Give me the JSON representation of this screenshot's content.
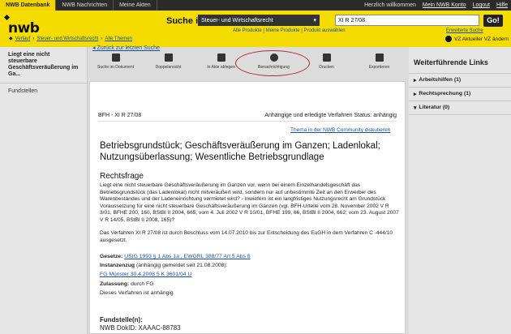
{
  "topbar": {
    "tabs": [
      "NWB Datenbank",
      "NWB Nachrichten",
      "Meine Akten"
    ],
    "greeting": "Herzlich willkommen",
    "links": [
      "Mein NWB Konto",
      "Logout",
      "Hilfe"
    ]
  },
  "header": {
    "logo": "nwb",
    "search_label": "Suche in",
    "search_scope": "Steuer- und Wirtschaftsrecht",
    "search_query": "XI R 27/08",
    "go_label": "Go!",
    "sublinks": "Alle Produkte | Meine Produkte | Produkt auswählen",
    "advanced_search": "Erweiterte Suche"
  },
  "breadcrumb": [
    "Verlauf",
    "Steuer- und Wirtschaftsrecht",
    "Alle Themen"
  ],
  "vz": "VZ  Aktueller VZ ändern",
  "left": {
    "title": "Liegt eine nicht steuerbare Geschäftsveräußerung im Ga...",
    "item": "Fundstellen"
  },
  "back_link": "Zurück zur letzten Suche",
  "toolbar": [
    {
      "icon": "search-doc-icon",
      "label": "Suche im Dokument"
    },
    {
      "icon": "split-view-icon",
      "label": "Doppelansicht"
    },
    {
      "icon": "file-add-icon",
      "label": "In Akte ablegen"
    },
    {
      "icon": "notification-icon",
      "label": "Benachrichtigung"
    },
    {
      "icon": "print-icon",
      "label": "Drucken"
    },
    {
      "icon": "export-icon",
      "label": "Exportieren"
    }
  ],
  "doc": {
    "court_ref": "BFH  - XI R 27/08",
    "status": "Anhängige und erledigte Verfahren Status: anhängig",
    "community": "Thema in der NWB Community diskutieren",
    "headline": "Betriebsgrundstück; Geschäftsveräußerung im Ganzen; Ladenlokal; Nutzungsüberlassung; Wesentliche Betriebsgrundlage",
    "section": "Rechtsfrage",
    "paragraph1": "Liegt eine nicht steuerbare Geschäftsveräußerung im Ganzen vor, wenn bei einem Einzelhandelsgeschäft das Betriebsgrundstück (das Ladenlokal) nicht mitveräußert wird, sondern nur auf unbestimmte Zeit an den Erwerber des Warenbestandes und der Ladeneinrichtung vermietet wird? - Inwiefern ist ein langfristiges Nutzungsrecht am Grundstück Voraussetzung für eine nicht steuerbare Geschäftsveräußerung im Ganzen (vgl. BFH-Urteile vom 28. November 2002 V R 3/01, BFHE 200, 160, BStBl II 2004, 665; vom 4. Juli 2002 V R 10/01, BFHE 199, 66, BStBl II 2004, 662; vom 23. August 2007 V R 14/05, BStBl II 2008, 165)?",
    "paragraph2": "Das Verfahren XI R 27/08 ist durch Beschluss vom 14.07.2010 bis zur Entscheidung des EuGH in dem Verfahren C -444/10 ausgesetzt.",
    "gesetze_label": "Gesetze:",
    "gesetze_value": "UStG 1993 § 1 Abs 1a , EWGRL 388/77 Art 5 Abs 8",
    "instanz_label": "Instanzenzug",
    "instanz_note": "(anhängig gemeldet seit 21.08.2008):",
    "instanz_value": "FG Münster 30.4.2008 5 K 3601/04 U",
    "zulassung_label": "Zulassung:",
    "zulassung_value": "durch FG",
    "verfahren_status": "Dieses Verfahren ist anhängig",
    "fundstelle_label": "Fundstelle(n):",
    "fundstelle_value": "NWB DokID: XAAAC-88783"
  },
  "right": {
    "header": "Weiterführende Links",
    "items": [
      {
        "arrow": "▸",
        "label": "Arbeitshilfen (1)"
      },
      {
        "arrow": "▸",
        "label": "Rechtsprechung (1)"
      },
      {
        "arrow": "▾",
        "label": "Literatur (0)"
      }
    ]
  }
}
